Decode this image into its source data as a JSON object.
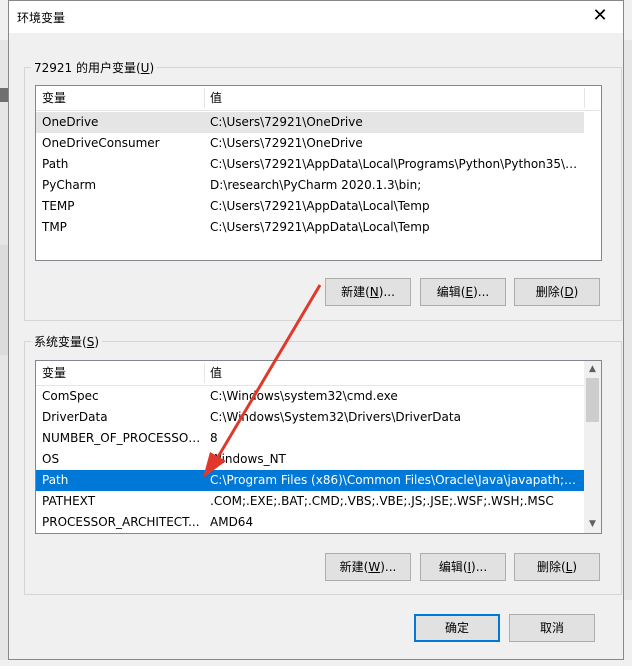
{
  "window": {
    "title": "环境变量",
    "close_glyph": "✕"
  },
  "user_vars": {
    "group_label_pre": "72921 的用户变量(",
    "group_label_key": "U",
    "group_label_post": ")",
    "col_name": "变量",
    "col_value": "值",
    "rows": [
      {
        "name": "OneDrive",
        "value": "C:\\Users\\72921\\OneDrive"
      },
      {
        "name": "OneDriveConsumer",
        "value": "C:\\Users\\72921\\OneDrive"
      },
      {
        "name": "Path",
        "value": "C:\\Users\\72921\\AppData\\Local\\Programs\\Python\\Python35\\S..."
      },
      {
        "name": "PyCharm",
        "value": "D:\\research\\PyCharm 2020.1.3\\bin;"
      },
      {
        "name": "TEMP",
        "value": "C:\\Users\\72921\\AppData\\Local\\Temp"
      },
      {
        "name": "TMP",
        "value": "C:\\Users\\72921\\AppData\\Local\\Temp"
      }
    ],
    "buttons": {
      "new": {
        "pre": "新建(",
        "key": "N",
        "post": ")..."
      },
      "edit": {
        "pre": "编辑(",
        "key": "E",
        "post": ")..."
      },
      "delete": {
        "pre": "删除(",
        "key": "D",
        "post": ")"
      }
    }
  },
  "sys_vars": {
    "group_label_pre": "系统变量(",
    "group_label_key": "S",
    "group_label_post": ")",
    "col_name": "变量",
    "col_value": "值",
    "rows": [
      {
        "name": "ComSpec",
        "value": "C:\\Windows\\system32\\cmd.exe"
      },
      {
        "name": "DriverData",
        "value": "C:\\Windows\\System32\\Drivers\\DriverData"
      },
      {
        "name": "NUMBER_OF_PROCESSORS",
        "value": "8"
      },
      {
        "name": "OS",
        "value": "Windows_NT"
      },
      {
        "name": "Path",
        "value": "C:\\Program Files (x86)\\Common Files\\Oracle\\Java\\javapath;C:..."
      },
      {
        "name": "PATHEXT",
        "value": ".COM;.EXE;.BAT;.CMD;.VBS;.VBE;.JS;.JSE;.WSF;.WSH;.MSC"
      },
      {
        "name": "PROCESSOR_ARCHITECT...",
        "value": "AMD64"
      }
    ],
    "buttons": {
      "new": {
        "pre": "新建(",
        "key": "W",
        "post": ")..."
      },
      "edit": {
        "pre": "编辑(",
        "key": "I",
        "post": ")..."
      },
      "delete": {
        "pre": "删除(",
        "key": "L",
        "post": ")"
      }
    }
  },
  "footer": {
    "ok": "确定",
    "cancel": "取消"
  },
  "annotation": {
    "color": "#e0392b"
  },
  "colors": {
    "selection": "#0078d7",
    "focus_border": "#0078d7"
  }
}
